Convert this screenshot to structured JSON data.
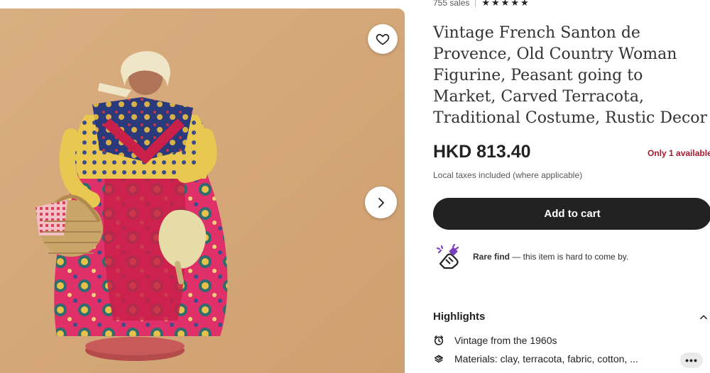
{
  "shop": {
    "sales": "755 sales",
    "stars": "★★★★★"
  },
  "listing": {
    "title": "Vintage French Santon de Provence, Old Country Woman Figurine, Peasant going to Market, Carved Terracota, Traditional Costume, Rustic Decor",
    "price": "HKD 813.40",
    "stock": "Only 1 available",
    "tax_note": "Local taxes included (where applicable)"
  },
  "actions": {
    "add_to_cart": "Add to cart"
  },
  "rare_find": {
    "bold": "Rare find",
    "text": " — this item is hard to come by."
  },
  "highlights": {
    "label": "Highlights",
    "items": [
      {
        "icon": "vintage-clock-icon",
        "text": "Vintage from the 1960s"
      },
      {
        "icon": "materials-icon",
        "text": "Materials: clay, terracota, fabric, cotton, ..."
      }
    ],
    "more_label": "•••"
  },
  "gallery": {
    "background": "#d7ab7c",
    "icons": [
      "heart-icon",
      "chevron-right-icon"
    ]
  }
}
